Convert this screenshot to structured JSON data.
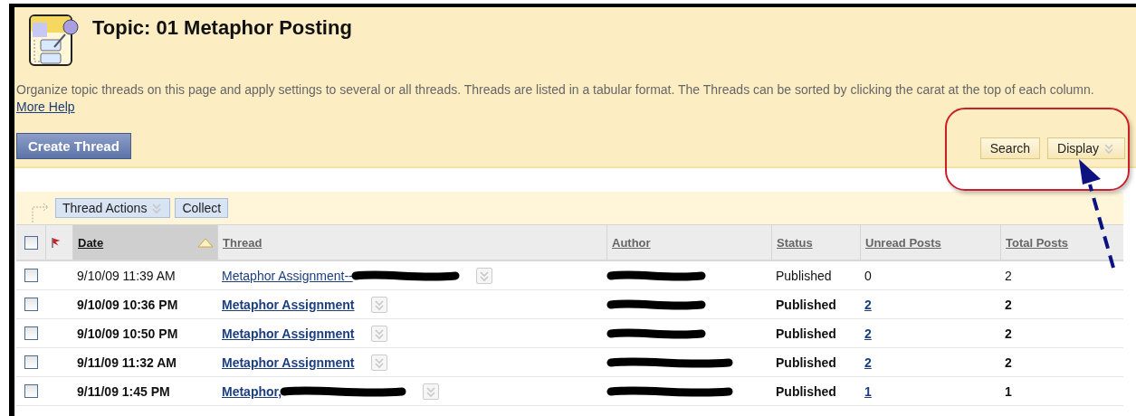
{
  "page": {
    "title": "Topic: 01 Metaphor Posting",
    "description": "Organize topic threads on this page and apply settings to several or all threads. Threads are listed in a tabular format. The Threads can be sorted by clicking the carat at the top of each column.",
    "help_link": "More Help"
  },
  "create_button": "Create Thread",
  "right_buttons": [
    {
      "label": "Search",
      "kind": "plain"
    },
    {
      "label": "Display",
      "kind": "menu"
    }
  ],
  "action_bar": {
    "buttons": [
      {
        "label": "Thread Actions",
        "kind": "menu"
      },
      {
        "label": "Collect",
        "kind": "plain"
      }
    ]
  },
  "table": {
    "select_all_checked": false,
    "columns": [
      {
        "label": "Date",
        "sorted": true
      },
      {
        "label": "Thread",
        "sorted": false
      },
      {
        "label": "Author",
        "sorted": false
      },
      {
        "label": "Status",
        "sorted": false
      },
      {
        "label": "Unread Posts",
        "sorted": false
      },
      {
        "label": "Total Posts",
        "sorted": false
      }
    ],
    "rows": [
      {
        "checked": false,
        "unread": false,
        "date": "9/10/09 11:39 AM",
        "thread": "Metaphor Assignment--",
        "thread_redacted": true,
        "status": "Published",
        "unread_posts": "0",
        "total_posts": "2"
      },
      {
        "checked": false,
        "unread": true,
        "date": "9/10/09 10:36 PM",
        "thread": "Metaphor Assignment ",
        "thread_redacted": false,
        "status": "Published",
        "unread_posts": "2",
        "total_posts": "2"
      },
      {
        "checked": false,
        "unread": true,
        "date": "9/10/09 10:50 PM",
        "thread": "Metaphor Assignment ",
        "thread_redacted": false,
        "status": "Published",
        "unread_posts": "2",
        "total_posts": "2"
      },
      {
        "checked": false,
        "unread": true,
        "date": "9/11/09 11:32 AM",
        "thread": "Metaphor Assignment ",
        "thread_redacted": false,
        "status": "Published",
        "unread_posts": "2",
        "total_posts": "2"
      },
      {
        "checked": false,
        "unread": true,
        "date": "9/11/09 1:45 PM",
        "thread": "Metaphor,",
        "thread_redacted": true,
        "status": "Published",
        "unread_posts": "1",
        "total_posts": "1"
      }
    ]
  }
}
